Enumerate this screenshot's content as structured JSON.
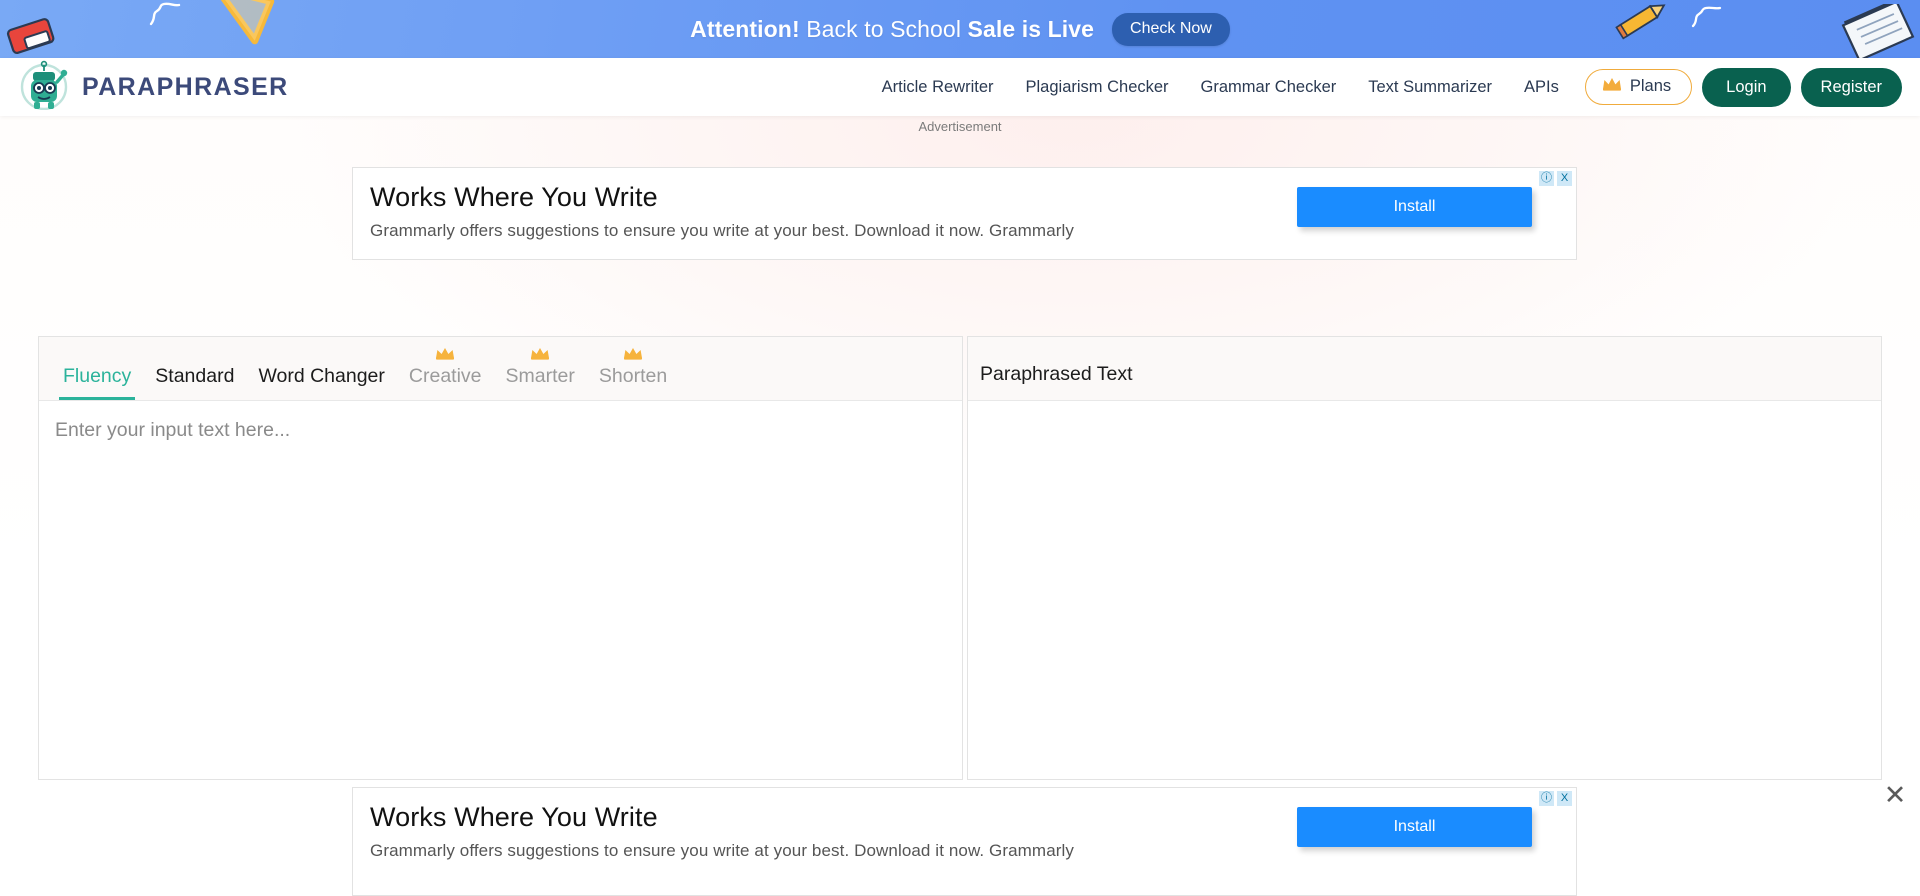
{
  "promo": {
    "prefix": "Attention!",
    "middle": " Back to School ",
    "suffix": "Sale is Live",
    "button_label": "Check Now",
    "bg_color": "#5f92f2",
    "button_color": "#2d5fb0"
  },
  "header": {
    "brand_name": "PARAPHRASER",
    "logo_icon": "robot-mascot-icon",
    "nav_links": [
      {
        "label": "Article Rewriter"
      },
      {
        "label": "Plagiarism Checker"
      },
      {
        "label": "Grammar Checker"
      },
      {
        "label": "Text Summarizer"
      },
      {
        "label": "APIs"
      }
    ],
    "plans": {
      "label": "Plans",
      "icon": "crown-icon",
      "border_color": "#f0ab3c"
    },
    "login_label": "Login",
    "register_label": "Register",
    "accent_color": "#09614f",
    "brand_color": "#3c4a7a"
  },
  "advertisement": {
    "label": "Advertisement",
    "headline": "Works Where You Write",
    "description": "Grammarly offers suggestions to ensure you write at your best. Download it now. Grammarly",
    "cta_label": "Install",
    "cta_color": "#1a8cff",
    "info_badge": "ⓘ",
    "close_badge": "X"
  },
  "tool": {
    "modes": [
      {
        "label": "Fluency",
        "premium": false,
        "active": true
      },
      {
        "label": "Standard",
        "premium": false,
        "active": false
      },
      {
        "label": "Word Changer",
        "premium": false,
        "active": false
      },
      {
        "label": "Creative",
        "premium": true,
        "active": false
      },
      {
        "label": "Smarter",
        "premium": true,
        "active": false
      },
      {
        "label": "Shorten",
        "premium": true,
        "active": false
      }
    ],
    "active_color": "#2bb39b",
    "input": {
      "placeholder": "Enter your input text here...",
      "value": ""
    },
    "output": {
      "title": "Paraphrased Text",
      "value": ""
    }
  },
  "page_close": {
    "label": "✕"
  }
}
